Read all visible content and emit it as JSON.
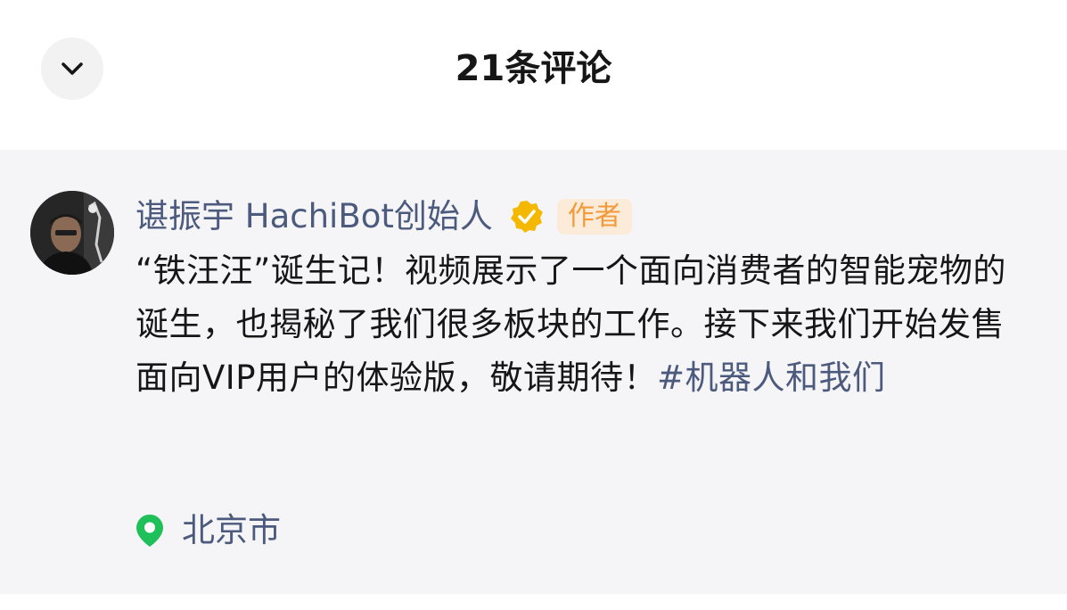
{
  "header": {
    "title": "21条评论",
    "collapse_icon": "chevron-down-icon"
  },
  "comment": {
    "author_name": "谌振宇 HachiBot创始人",
    "verified_icon": "verified-badge-icon",
    "author_badge": "作者",
    "text": "“铁汪汪”诞生记！视频展示了一个面向消费者的智能宠物的诞生，也揭秘了我们很多板块的工作。接下来我们开始发售面向VIP用户的体验版，敬请期待！",
    "hashtag": "#机器人和我们",
    "location_icon": "location-pin-icon",
    "location": "北京市"
  },
  "colors": {
    "link_blue": "#4c5a7e",
    "badge_bg": "#fcebd9",
    "badge_text": "#f29a3a",
    "verified_gold": "#f5b800",
    "location_green": "#1fc05a",
    "card_bg": "#f5f5f7"
  }
}
